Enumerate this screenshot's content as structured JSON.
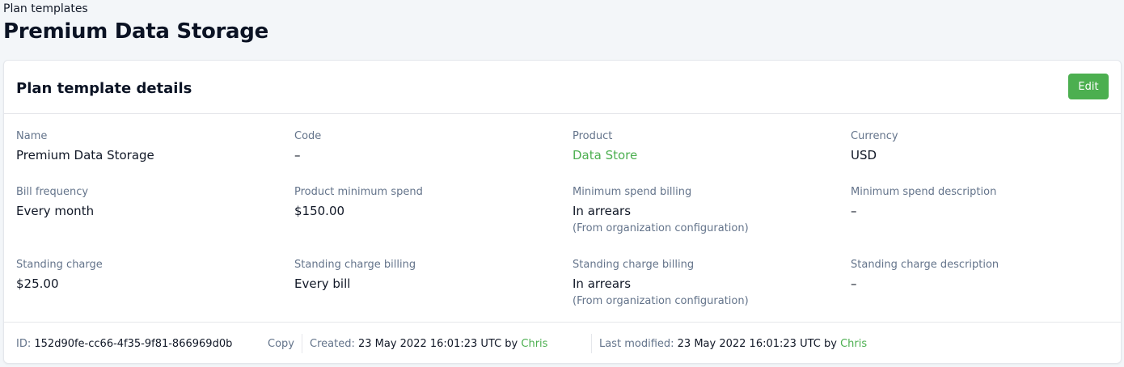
{
  "breadcrumb": "Plan templates",
  "page_title": "Premium Data Storage",
  "card": {
    "title": "Plan template details",
    "edit_label": "Edit"
  },
  "fields": {
    "name": {
      "label": "Name",
      "value": "Premium Data Storage"
    },
    "code": {
      "label": "Code",
      "value": "–"
    },
    "product": {
      "label": "Product",
      "value": "Data Store"
    },
    "currency": {
      "label": "Currency",
      "value": "USD"
    },
    "bill_frequency": {
      "label": "Bill frequency",
      "value": "Every month"
    },
    "product_min_spend": {
      "label": "Product minimum spend",
      "value": "$150.00"
    },
    "min_spend_billing": {
      "label": "Minimum spend billing",
      "value": "In arrears",
      "note": "(From organization configuration)"
    },
    "min_spend_description": {
      "label": "Minimum spend description",
      "value": "–"
    },
    "standing_charge": {
      "label": "Standing charge",
      "value": "$25.00"
    },
    "standing_charge_billing_freq": {
      "label": "Standing charge billing",
      "value": "Every bill"
    },
    "standing_charge_billing": {
      "label": "Standing charge billing",
      "value": "In arrears",
      "note": "(From organization configuration)"
    },
    "standing_charge_description": {
      "label": "Standing charge description",
      "value": "–"
    }
  },
  "footer": {
    "id_label": "ID:",
    "id_value": "152d90fe-cc66-4f35-9f81-866969d0b",
    "copy_label": "Copy",
    "created_label": "Created:",
    "created_value": "23 May 2022 16:01:23 UTC by",
    "created_by": "Chris",
    "modified_label": "Last modified:",
    "modified_value": "23 May 2022 16:01:23 UTC by",
    "modified_by": "Chris"
  },
  "colors": {
    "accent": "#4caf50",
    "label": "#64748b",
    "background": "#f3f6f9"
  }
}
